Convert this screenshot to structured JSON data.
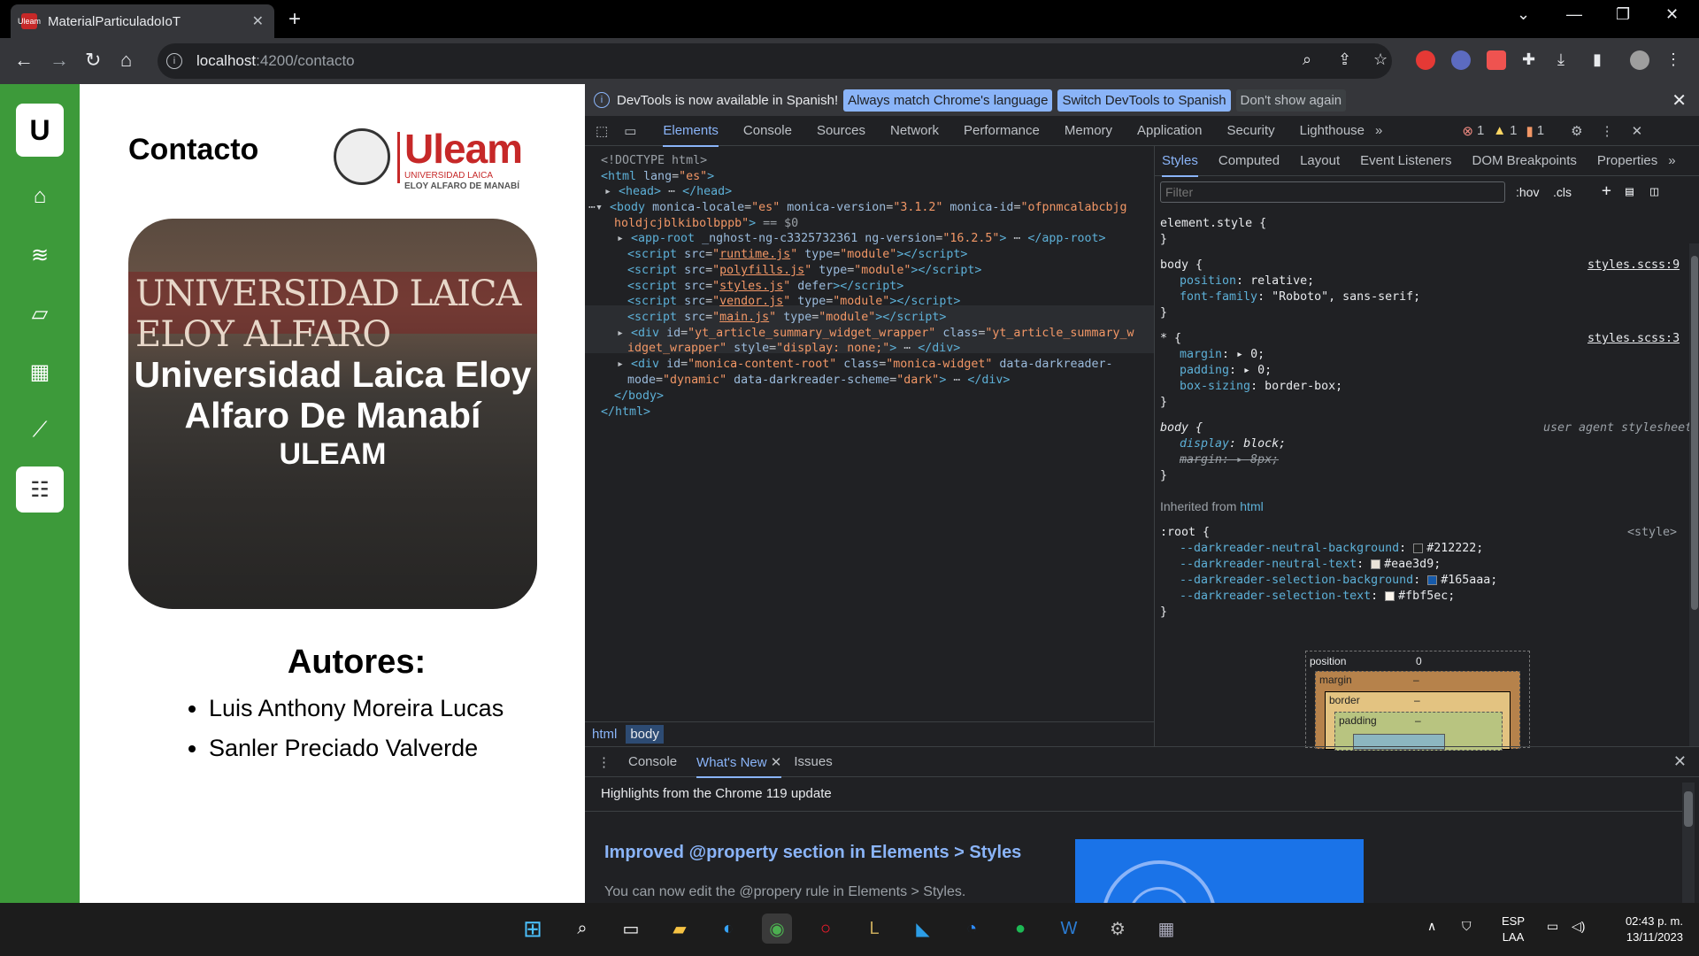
{
  "browser": {
    "tab_title": "MaterialParticuladoIoT",
    "favicon_text": "Uleam",
    "new_tab": "+",
    "tab_close": "✕",
    "url_host": "localhost",
    "url_path": ":4200/contacto"
  },
  "page": {
    "logo_letter": "U",
    "title": "Contacto",
    "uleam_word": "Uleam",
    "uleam_sub1": "UNIVERSIDAD LAICA",
    "uleam_sub2": "ELOY ALFARO DE MANABÍ",
    "hero_sign": "UNIVERSIDAD LAICA ELOY ALFARO",
    "hero_title": "Universidad Laica Eloy Alfaro De Manabí",
    "hero_subtitle": "ULEAM",
    "authors_title": "Autores:",
    "authors": [
      "Luis Anthony Moreira Lucas",
      "Sanler Preciado Valverde"
    ]
  },
  "devtools": {
    "infobar_text": "DevTools is now available in Spanish!",
    "infobar_btn1": "Always match Chrome's language",
    "infobar_btn2": "Switch DevTools to Spanish",
    "infobar_btn3": "Don't show again",
    "tabs": [
      "Elements",
      "Console",
      "Sources",
      "Network",
      "Performance",
      "Memory",
      "Application",
      "Security",
      "Lighthouse"
    ],
    "more_tabs": "»",
    "errors": "1",
    "warnings": "1",
    "issues": "1",
    "styles_tabs": [
      "Styles",
      "Computed",
      "Layout",
      "Event Listeners",
      "DOM Breakpoints",
      "Properties"
    ],
    "filter_placeholder": "Filter",
    "hov": ":hov",
    "cls": ".cls",
    "breadcrumb": [
      "html",
      "body"
    ],
    "inherited_from": "Inherited from",
    "inherited_html": "html",
    "boxmodel": {
      "position": "position",
      "position_val": "0",
      "margin": "margin",
      "margin_val": "–",
      "border": "border",
      "border_val": "–",
      "padding": "padding",
      "padding_val": "–"
    },
    "drawer_tabs": [
      "Console",
      "What's New",
      "Issues"
    ],
    "drawer_tab_close": "✕",
    "drawer_highlight": "Highlights from the Chrome 119 update",
    "drawer_heading": "Improved @property section in Elements > Styles",
    "drawer_body": "You can now edit the @propery rule in Elements > Styles."
  },
  "taskbar": {
    "lang1": "ESP",
    "lang2": "LAA",
    "time": "02:43 p. m.",
    "date": "13/11/2023"
  }
}
